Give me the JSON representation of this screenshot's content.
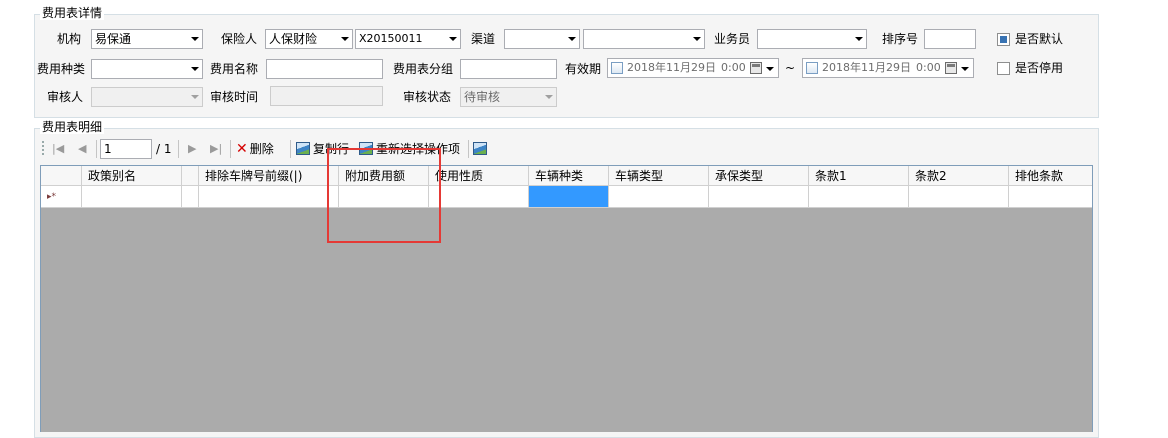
{
  "detail_section": {
    "title": "费用表详情",
    "org_label": "机构",
    "org_value": "易保通",
    "insurer_label": "保险人",
    "insurer_value": "人保财险",
    "insurer_code": "X20150011",
    "insurer_code_value": "",
    "channel_label": "渠道",
    "channel_value": "",
    "channel_sub_value": "",
    "salesman_label": "业务员",
    "salesman_value": "",
    "sort_label": "排序号",
    "sort_value": "",
    "is_default_label": "是否默认",
    "is_default_checked": true,
    "fee_type_label": "费用种类",
    "fee_type_value": "",
    "fee_name_label": "费用名称",
    "fee_name_value": "",
    "fee_group_label": "费用表分组",
    "fee_group_value": "",
    "valid_period_label": "有效期",
    "valid_from_date": "2018年11月29日",
    "valid_from_time": "0:00",
    "valid_sep": "~",
    "valid_to_date": "2018年11月29日",
    "valid_to_time": "0:00",
    "is_disabled_label": "是否停用",
    "is_disabled_checked": false,
    "reviewer_label": "审核人",
    "reviewer_value": "",
    "review_time_label": "审核时间",
    "review_time_value": "",
    "review_status_label": "审核状态",
    "review_status_value": "待审核"
  },
  "detail_list": {
    "title": "费用表明细",
    "toolbar": {
      "position_value": "1",
      "total_pages": "/ 1",
      "delete_label": "删除",
      "copy_label": "复制行",
      "reselect_label": "重新选择操作项"
    },
    "columns": [
      "政策别名",
      "",
      "排除车牌号前缀(|)",
      "附加费用额",
      "使用性质",
      "车辆种类",
      "车辆类型",
      "承保类型",
      "条款1",
      "条款2",
      "排他条款"
    ],
    "new_row_indicator": "▸*"
  },
  "colors": {
    "highlight_box": "#e53935",
    "selected_cell": "#3399ff",
    "grid_background": "#ababab"
  }
}
